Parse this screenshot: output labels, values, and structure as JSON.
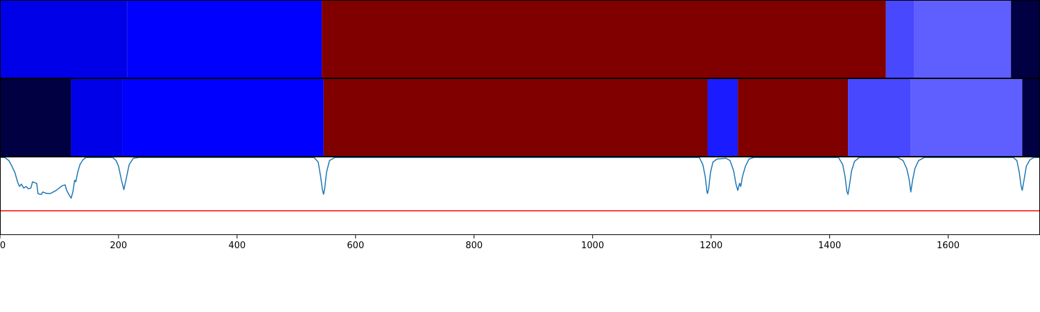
{
  "chart_data": [
    {
      "type": "heatmap",
      "panel": "segmentation-top",
      "xlim": [
        0,
        1755
      ],
      "segments": [
        {
          "start": 0,
          "end": 215,
          "color": "#0000e8"
        },
        {
          "start": 215,
          "end": 543,
          "color": "#0000ff"
        },
        {
          "start": 543,
          "end": 1495,
          "color": "#800000"
        },
        {
          "start": 1495,
          "end": 1543,
          "color": "#4848ff"
        },
        {
          "start": 1543,
          "end": 1706,
          "color": "#5f5fff"
        },
        {
          "start": 1706,
          "end": 1755,
          "color": "#000042"
        }
      ]
    },
    {
      "type": "heatmap",
      "panel": "segmentation-bottom",
      "xlim": [
        0,
        1755
      ],
      "segments": [
        {
          "start": 0,
          "end": 120,
          "color": "#000042"
        },
        {
          "start": 120,
          "end": 207,
          "color": "#0000e8"
        },
        {
          "start": 207,
          "end": 546,
          "color": "#0000ff"
        },
        {
          "start": 546,
          "end": 1194,
          "color": "#800000"
        },
        {
          "start": 1194,
          "end": 1245,
          "color": "#1b1bff"
        },
        {
          "start": 1245,
          "end": 1431,
          "color": "#800000"
        },
        {
          "start": 1431,
          "end": 1537,
          "color": "#4848ff"
        },
        {
          "start": 1537,
          "end": 1725,
          "color": "#5f5fff"
        },
        {
          "start": 1725,
          "end": 1755,
          "color": "#000042"
        }
      ]
    },
    {
      "type": "line",
      "panel": "boundary-probability",
      "xlim": [
        0,
        1755
      ],
      "ylim": [
        0,
        1
      ],
      "xticks": [
        0,
        200,
        400,
        600,
        800,
        1000,
        1200,
        1400,
        1600
      ],
      "xtick_labels": [
        "0",
        "200",
        "400",
        "600",
        "800",
        "1000",
        "1200",
        "1400",
        "1600"
      ],
      "series": [
        {
          "color": "#1f77b4",
          "points": [
            [
              0,
              0.99
            ],
            [
              8,
              0.99
            ],
            [
              15,
              0.95
            ],
            [
              20,
              0.88
            ],
            [
              25,
              0.8
            ],
            [
              30,
              0.67
            ],
            [
              33,
              0.62
            ],
            [
              36,
              0.65
            ],
            [
              40,
              0.6
            ],
            [
              44,
              0.62
            ],
            [
              48,
              0.59
            ],
            [
              52,
              0.6
            ],
            [
              55,
              0.68
            ],
            [
              58,
              0.67
            ],
            [
              62,
              0.66
            ],
            [
              64,
              0.53
            ],
            [
              67,
              0.52
            ],
            [
              70,
              0.52
            ],
            [
              72,
              0.55
            ],
            [
              75,
              0.54
            ],
            [
              80,
              0.53
            ],
            [
              85,
              0.53
            ],
            [
              90,
              0.55
            ],
            [
              95,
              0.57
            ],
            [
              100,
              0.6
            ],
            [
              105,
              0.63
            ],
            [
              110,
              0.64
            ],
            [
              112,
              0.58
            ],
            [
              116,
              0.52
            ],
            [
              120,
              0.47
            ],
            [
              123,
              0.55
            ],
            [
              126,
              0.7
            ],
            [
              128,
              0.68
            ],
            [
              131,
              0.8
            ],
            [
              135,
              0.9
            ],
            [
              140,
              0.96
            ],
            [
              145,
              0.99
            ],
            [
              160,
              0.99
            ],
            [
              190,
              0.99
            ],
            [
              196,
              0.95
            ],
            [
              200,
              0.88
            ],
            [
              205,
              0.7
            ],
            [
              209,
              0.58
            ],
            [
              213,
              0.72
            ],
            [
              218,
              0.9
            ],
            [
              225,
              0.98
            ],
            [
              235,
              0.99
            ],
            [
              530,
              0.99
            ],
            [
              537,
              0.93
            ],
            [
              541,
              0.75
            ],
            [
              544,
              0.58
            ],
            [
              546,
              0.52
            ],
            [
              548,
              0.6
            ],
            [
              551,
              0.8
            ],
            [
              556,
              0.95
            ],
            [
              565,
              0.99
            ],
            [
              1180,
              0.99
            ],
            [
              1186,
              0.9
            ],
            [
              1190,
              0.75
            ],
            [
              1193,
              0.55
            ],
            [
              1194,
              0.53
            ],
            [
              1196,
              0.6
            ],
            [
              1199,
              0.8
            ],
            [
              1203,
              0.93
            ],
            [
              1210,
              0.97
            ],
            [
              1225,
              0.98
            ],
            [
              1232,
              0.95
            ],
            [
              1238,
              0.82
            ],
            [
              1242,
              0.65
            ],
            [
              1245,
              0.57
            ],
            [
              1248,
              0.66
            ],
            [
              1250,
              0.62
            ],
            [
              1253,
              0.75
            ],
            [
              1258,
              0.88
            ],
            [
              1264,
              0.97
            ],
            [
              1272,
              0.99
            ],
            [
              1415,
              0.99
            ],
            [
              1422,
              0.9
            ],
            [
              1426,
              0.75
            ],
            [
              1429,
              0.56
            ],
            [
              1431,
              0.52
            ],
            [
              1434,
              0.66
            ],
            [
              1437,
              0.82
            ],
            [
              1442,
              0.94
            ],
            [
              1450,
              0.99
            ],
            [
              1515,
              0.99
            ],
            [
              1524,
              0.95
            ],
            [
              1530,
              0.85
            ],
            [
              1534,
              0.72
            ],
            [
              1537,
              0.55
            ],
            [
              1540,
              0.7
            ],
            [
              1544,
              0.85
            ],
            [
              1550,
              0.95
            ],
            [
              1560,
              0.99
            ],
            [
              1710,
              0.99
            ],
            [
              1716,
              0.95
            ],
            [
              1720,
              0.8
            ],
            [
              1723,
              0.63
            ],
            [
              1725,
              0.57
            ],
            [
              1728,
              0.7
            ],
            [
              1732,
              0.88
            ],
            [
              1738,
              0.96
            ],
            [
              1745,
              0.99
            ],
            [
              1755,
              0.99
            ]
          ]
        },
        {
          "color": "#ff0000",
          "points": [
            [
              0,
              0.31
            ],
            [
              1755,
              0.31
            ]
          ]
        }
      ]
    }
  ]
}
